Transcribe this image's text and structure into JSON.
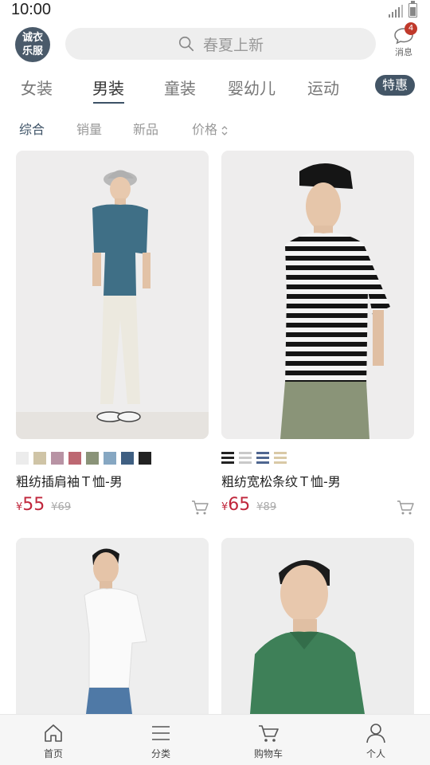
{
  "status_bar": {
    "time": "10:00"
  },
  "header": {
    "logo_line1": "诚衣",
    "logo_line2": "乐服",
    "search_placeholder": "春夏上新",
    "message_label": "消息",
    "message_badge": "4"
  },
  "tabs": [
    {
      "label": "女装",
      "active": false
    },
    {
      "label": "男装",
      "active": true
    },
    {
      "label": "童装",
      "active": false
    },
    {
      "label": "婴幼儿",
      "active": false
    },
    {
      "label": "运动",
      "active": false
    }
  ],
  "tab_special": "特惠",
  "sort": [
    {
      "label": "综合",
      "active": true
    },
    {
      "label": "销量",
      "active": false
    },
    {
      "label": "新品",
      "active": false
    },
    {
      "label": "价格",
      "active": false
    }
  ],
  "products": [
    {
      "title": "粗纺插肩袖Ｔ恤-男",
      "currency": "¥",
      "price": "55",
      "original_price": "¥69",
      "swatch_colors": [
        "#ececec",
        "#cfc4a6",
        "#b893a4",
        "#bd6872",
        "#8a9378",
        "#86a7c2",
        "#3f5f82",
        "#222222"
      ]
    },
    {
      "title": "粗纺宽松条纹Ｔ恤-男",
      "currency": "¥",
      "price": "65",
      "original_price": "¥89",
      "swatch_colors": [
        "#222222",
        "#c9c9c9",
        "#4f6690",
        "#d9c9a6"
      ]
    },
    {
      "title": "",
      "price": "",
      "original_price": ""
    },
    {
      "title": "",
      "price": "",
      "original_price": ""
    }
  ],
  "bottom_nav": [
    {
      "label": "首页",
      "icon": "home-icon"
    },
    {
      "label": "分类",
      "icon": "menu-icon"
    },
    {
      "label": "购物车",
      "icon": "cart-icon"
    },
    {
      "label": "个人",
      "icon": "person-icon"
    }
  ],
  "colors": {
    "accent": "#3d5266",
    "price_red": "#c0263b",
    "badge_red": "#c0392b"
  }
}
